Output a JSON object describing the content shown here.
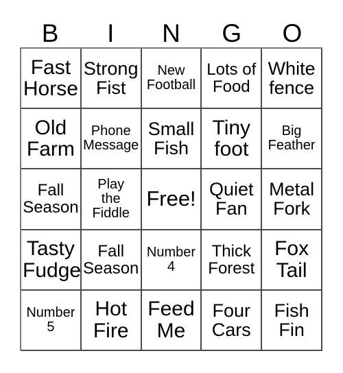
{
  "card": {
    "header_letters": [
      "B",
      "I",
      "N",
      "G",
      "O"
    ],
    "free_space_label": "Free!",
    "colors": {
      "background": "#ffffff",
      "text": "#000000",
      "grid_line": "#4a4a4a"
    },
    "rows": [
      [
        {
          "text": "Fast\nHorse",
          "size": "fs-xl"
        },
        {
          "text": "Strong\nFist",
          "size": "fs-lg"
        },
        {
          "text": "New\nFootball",
          "size": "fs-sm"
        },
        {
          "text": "Lots of\nFood",
          "size": "fs-md"
        },
        {
          "text": "White\nfence",
          "size": "fs-lg"
        }
      ],
      [
        {
          "text": "Old\nFarm",
          "size": "fs-xl"
        },
        {
          "text": "Phone\nMessage",
          "size": "fs-sm"
        },
        {
          "text": "Small\nFish",
          "size": "fs-lg"
        },
        {
          "text": "Tiny\nfoot",
          "size": "fs-xl"
        },
        {
          "text": "Big\nFeather",
          "size": "fs-sm"
        }
      ],
      [
        {
          "text": "Fall\nSeason",
          "size": "fs-md"
        },
        {
          "text": "Play\nthe\nFiddle",
          "size": "fs-sm"
        },
        {
          "text": "Free!",
          "size": "fs-free"
        },
        {
          "text": "Quiet\nFan",
          "size": "fs-lg"
        },
        {
          "text": "Metal\nFork",
          "size": "fs-lg"
        }
      ],
      [
        {
          "text": "Tasty\nFudge",
          "size": "fs-xl"
        },
        {
          "text": "Fall\nSeason",
          "size": "fs-md"
        },
        {
          "text": "Number\n4",
          "size": "fs-sm"
        },
        {
          "text": "Thick\nForest",
          "size": "fs-md"
        },
        {
          "text": "Fox\nTail",
          "size": "fs-xl"
        }
      ],
      [
        {
          "text": "Number\n5",
          "size": "fs-sm"
        },
        {
          "text": "Hot\nFire",
          "size": "fs-xl"
        },
        {
          "text": "Feed\nMe",
          "size": "fs-xl"
        },
        {
          "text": "Four\nCars",
          "size": "fs-lg"
        },
        {
          "text": "Fish\nFin",
          "size": "fs-lg"
        }
      ]
    ]
  }
}
